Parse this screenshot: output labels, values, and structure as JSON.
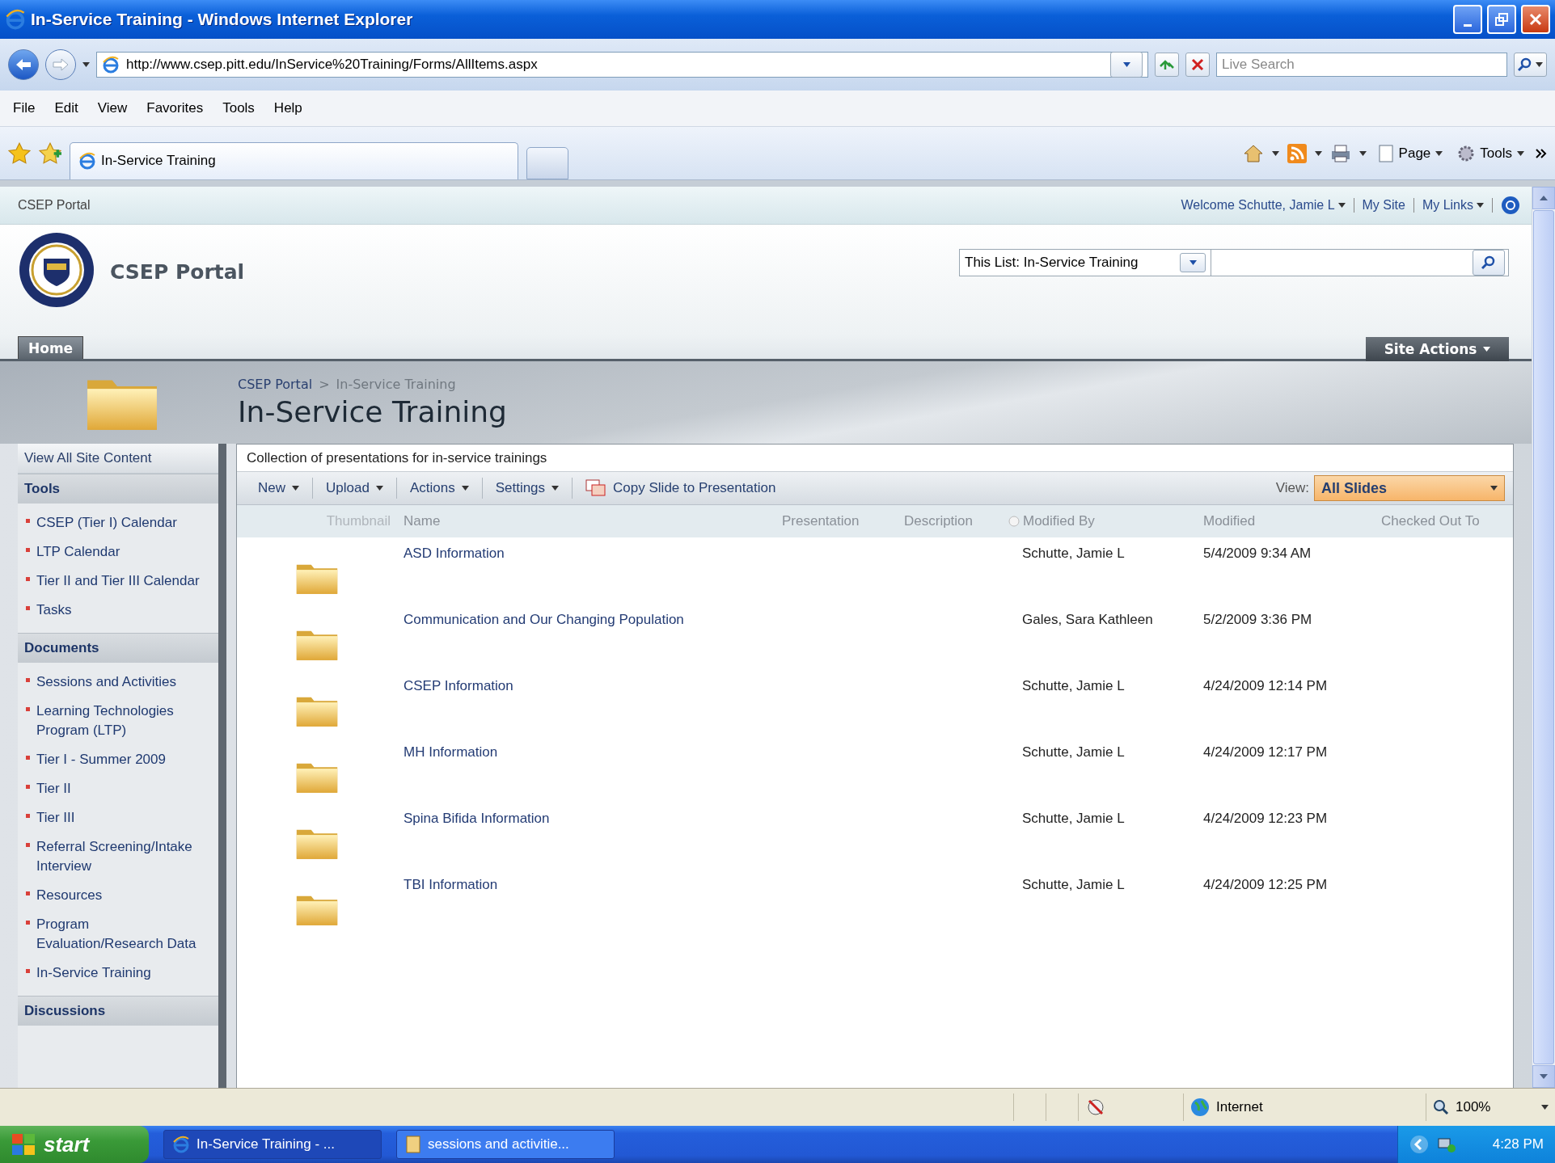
{
  "window": {
    "title": "In-Service Training - Windows Internet Explorer"
  },
  "address": {
    "url": "http://www.csep.pitt.edu/InService%20Training/Forms/AllItems.aspx",
    "search_placeholder": "Live Search"
  },
  "menu": [
    "File",
    "Edit",
    "View",
    "Favorites",
    "Tools",
    "Help"
  ],
  "browser_tabs": [
    {
      "label": "In-Service Training",
      "selected": true
    }
  ],
  "command_bar": [
    "Page",
    "Tools"
  ],
  "portal": {
    "site_link": "CSEP Portal",
    "welcome": "Welcome Schutte, Jamie L",
    "my_site": "My Site",
    "my_links": "My Links",
    "search_scope": "This List: In-Service Training",
    "site_title": "CSEP Portal",
    "tabs": [
      {
        "label": "Home",
        "selected": true
      }
    ],
    "site_actions": "Site Actions",
    "breadcrumb": [
      "CSEP Portal",
      "In-Service Training"
    ],
    "breadcrumb_separator": ">",
    "page_title": "In-Service Training"
  },
  "sidebar": {
    "view_all": "View All Site Content",
    "sections": [
      {
        "heading": "Tools",
        "items": [
          "CSEP (Tier I) Calendar",
          "LTP Calendar",
          "Tier II and Tier III Calendar",
          "Tasks"
        ]
      },
      {
        "heading": "Documents",
        "items": [
          "Sessions and Activities",
          "Learning Technologies Program (LTP)",
          "Tier I - Summer 2009",
          "Tier II",
          "Tier III",
          "Referral Screening/Intake Interview",
          "Resources",
          "Program Evaluation/Research Data",
          "In-Service Training"
        ]
      },
      {
        "heading": "Discussions"
      }
    ]
  },
  "list": {
    "description": "Collection of presentations for in-service trainings",
    "toolbar": [
      "New",
      "Upload",
      "Actions",
      "Settings"
    ],
    "copy_slide": "Copy Slide to Presentation",
    "view_label": "View:",
    "view_value": "All Slides",
    "columns": [
      {
        "label": "Thumbnail",
        "kind": "plain"
      },
      {
        "label": "Name",
        "kind": "plain"
      },
      {
        "label": "Presentation",
        "kind": "plain"
      },
      {
        "label": "Description",
        "kind": "plain"
      },
      {
        "label": "Modified By",
        "kind": "person"
      },
      {
        "label": "Modified",
        "kind": "plain"
      },
      {
        "label": "Checked Out To",
        "kind": "plain"
      }
    ],
    "rows": [
      {
        "name": "ASD Information",
        "modified_by": "Schutte, Jamie L",
        "modified": "5/4/2009 9:34 AM"
      },
      {
        "name": "Communication and Our Changing Population",
        "modified_by": "Gales, Sara Kathleen",
        "modified": "5/2/2009 3:36 PM"
      },
      {
        "name": "CSEP Information",
        "modified_by": "Schutte, Jamie L",
        "modified": "4/24/2009 12:14 PM"
      },
      {
        "name": "MH Information",
        "modified_by": "Schutte, Jamie L",
        "modified": "4/24/2009 12:17 PM"
      },
      {
        "name": "Spina Bifida Information",
        "modified_by": "Schutte, Jamie L",
        "modified": "4/24/2009 12:23 PM"
      },
      {
        "name": "TBI Information",
        "modified_by": "Schutte, Jamie L",
        "modified": "4/24/2009 12:25 PM"
      }
    ]
  },
  "status_bar": {
    "zone": "Internet",
    "zoom": "100%"
  },
  "taskbar": {
    "start": "start",
    "tasks": [
      {
        "label": "In-Service Training - ...",
        "selected": true
      },
      {
        "label": "sessions and activitie...",
        "selected": false
      }
    ],
    "clock": "4:28 PM"
  }
}
